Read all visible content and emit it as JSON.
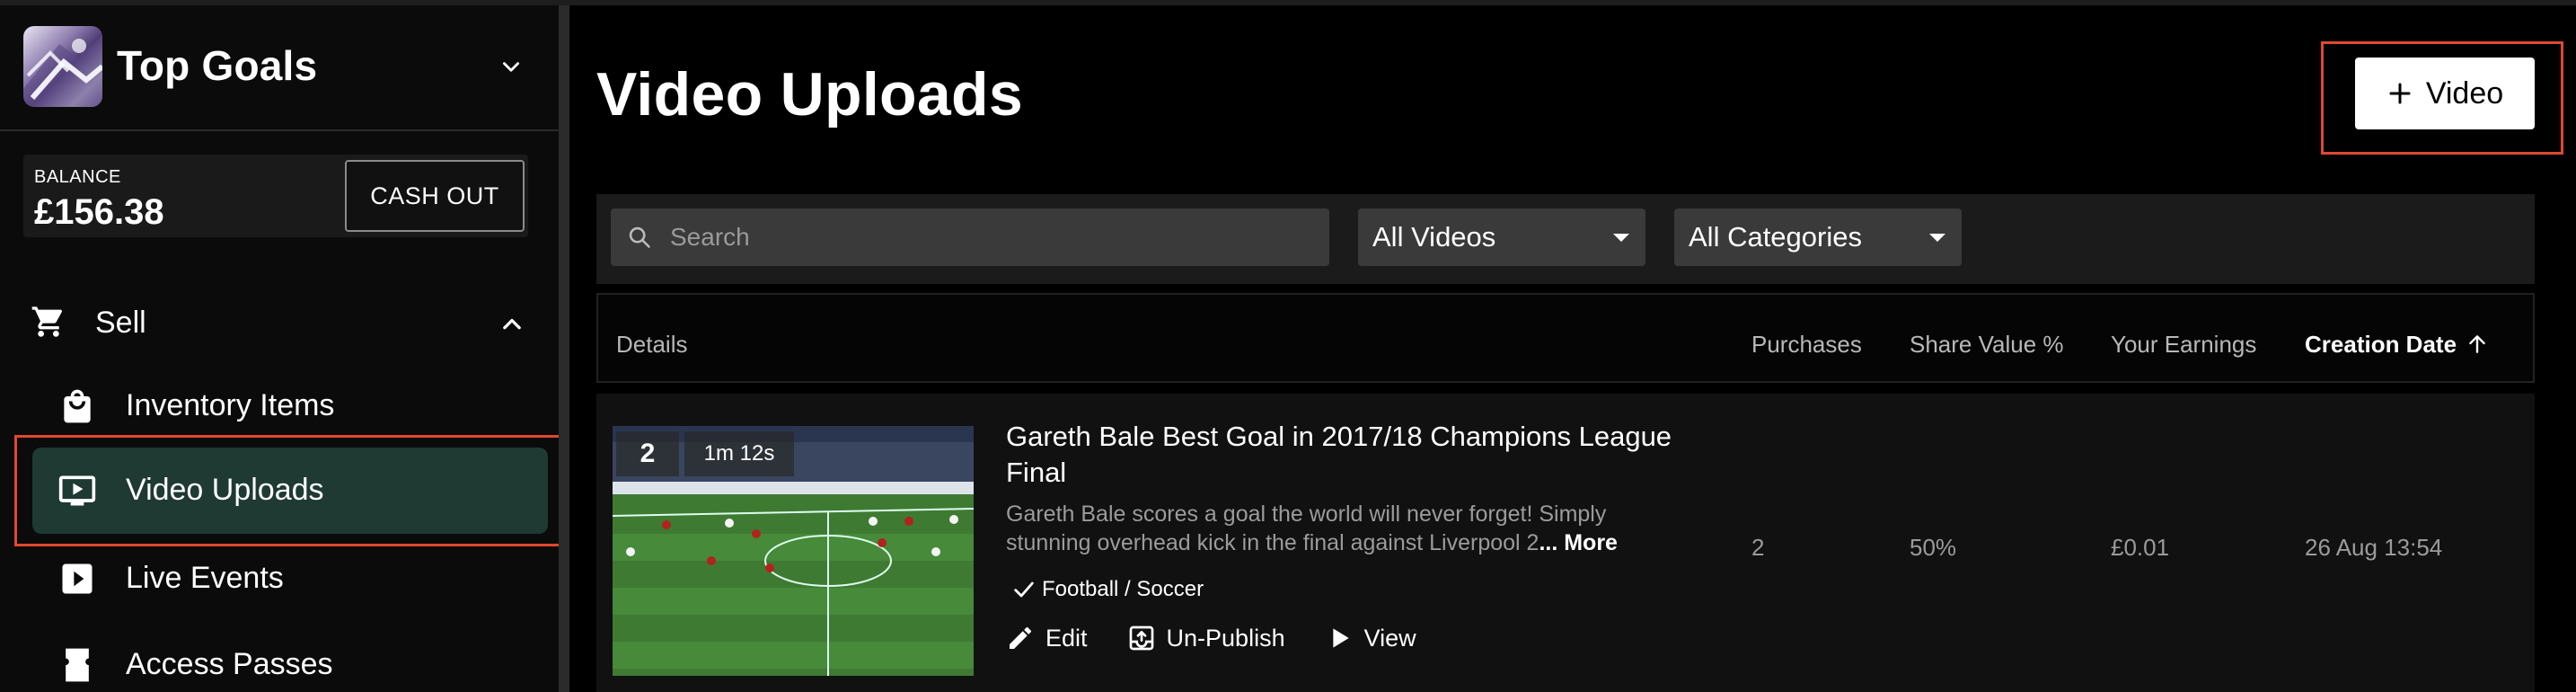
{
  "workspace": {
    "name": "Top Goals"
  },
  "balance": {
    "label": "BALANCE",
    "value": "£156.38",
    "cashout_label": "CASH OUT"
  },
  "nav": {
    "section": {
      "label": "Sell",
      "icon": "cart-icon"
    },
    "items": [
      {
        "label": "Inventory Items",
        "icon": "bag-icon"
      },
      {
        "label": "Video Uploads",
        "icon": "tv-play-icon",
        "active": true
      },
      {
        "label": "Live Events",
        "icon": "play-box-icon"
      },
      {
        "label": "Access Passes",
        "icon": "ticket-icon"
      }
    ]
  },
  "page": {
    "title": "Video Uploads",
    "add_button_label": "Video"
  },
  "filters": {
    "search_placeholder": "Search",
    "video_filter": "All Videos",
    "category_filter": "All Categories"
  },
  "table": {
    "columns": {
      "details": "Details",
      "purchases": "Purchases",
      "share_value": "Share Value %",
      "earnings": "Your Earnings",
      "creation_date": "Creation Date"
    },
    "rows": [
      {
        "count_badge": "2",
        "duration": "1m 12s",
        "title": "Gareth Bale Best Goal in 2017/18 Champions League Final",
        "description": "Gareth Bale scores a goal the world will never forget! Simply stunning overhead kick in the final against Liverpool 2",
        "more_label": "... More",
        "category": "Football / Soccer",
        "actions": {
          "edit": "Edit",
          "unpublish": "Un-Publish",
          "view": "View"
        },
        "purchases": "2",
        "share_value": "50%",
        "earnings": "£0.01",
        "creation_date": "26 Aug 13:54"
      }
    ]
  },
  "colors": {
    "accent_active": "#1e3a32",
    "highlight": "#e0482f",
    "background": "#000000",
    "surface": "#1b1b1b"
  }
}
